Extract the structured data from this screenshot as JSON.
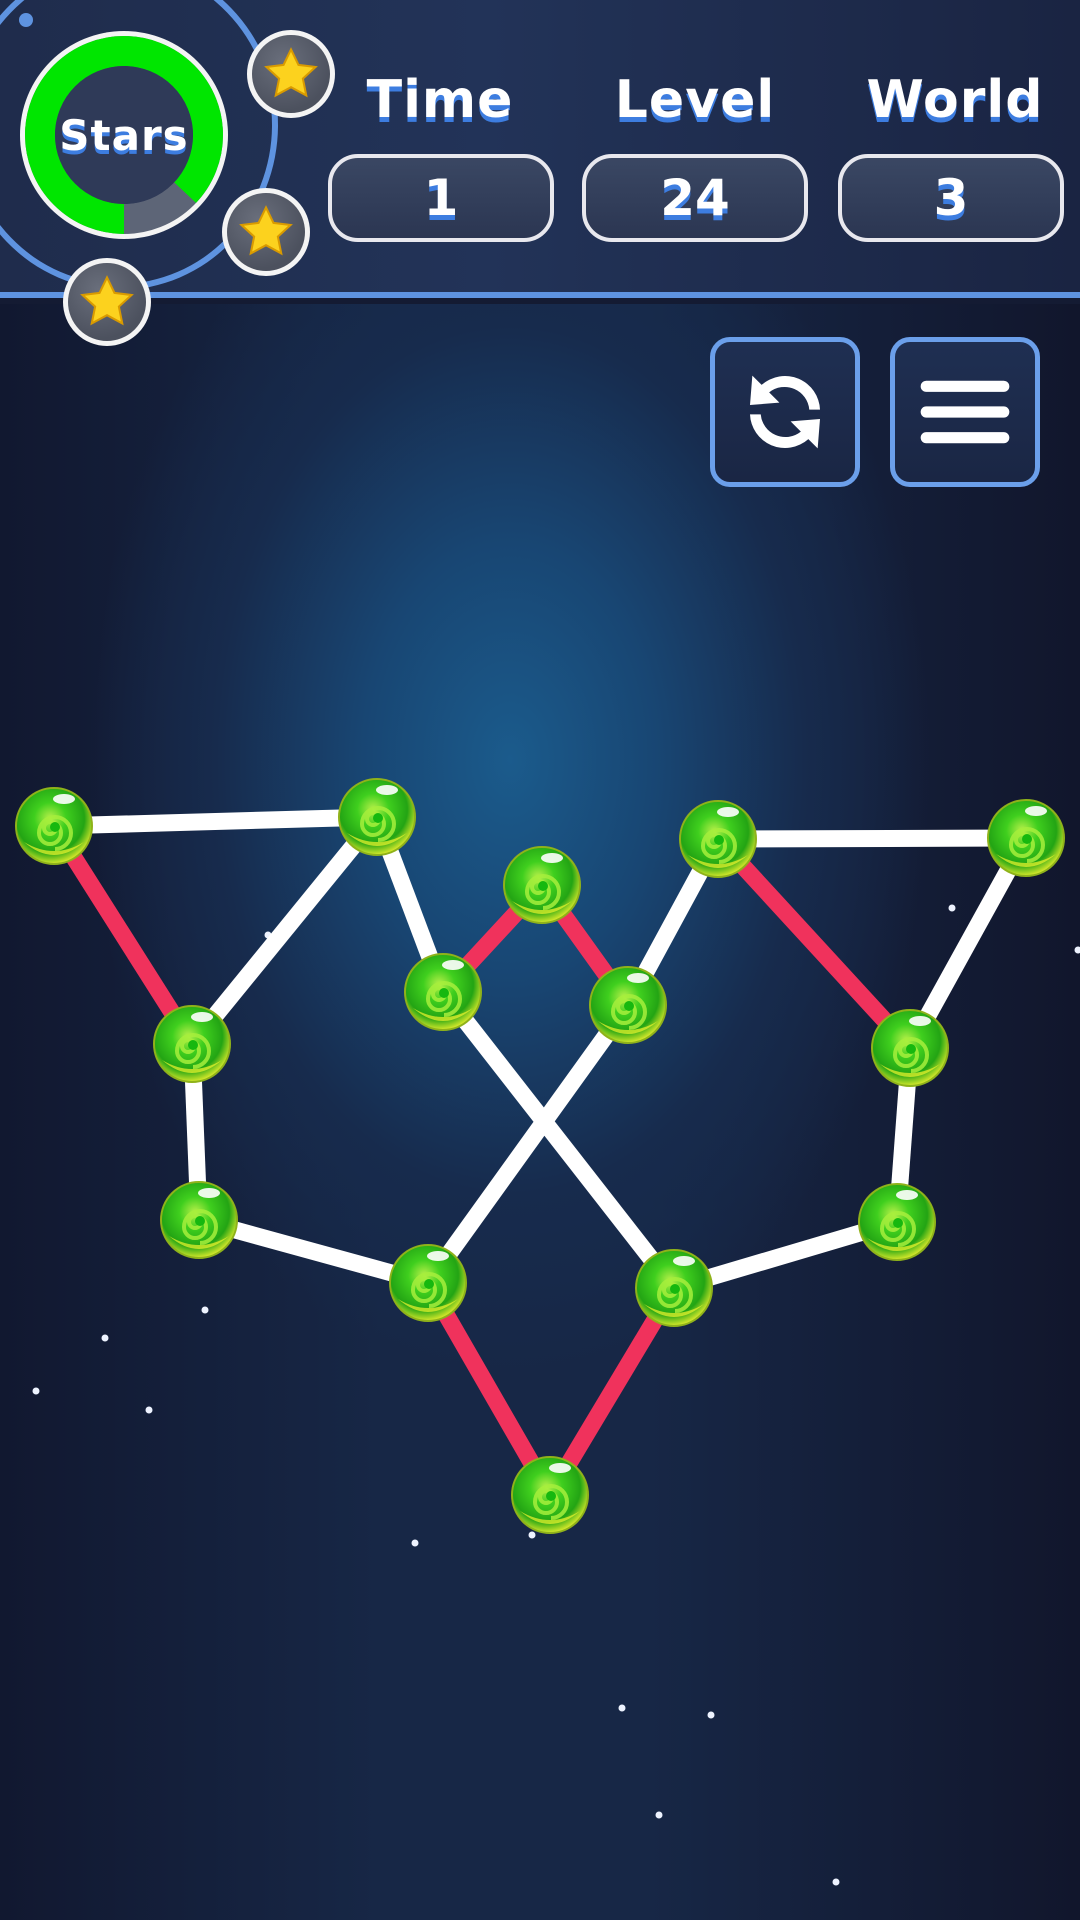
{
  "hud": {
    "stars_label": "Stars",
    "stars_progress": 0.87,
    "stars_earned": 3,
    "stats": [
      {
        "label": "Time",
        "value": "1"
      },
      {
        "label": "Level",
        "value": "24"
      },
      {
        "label": "World",
        "value": "3"
      }
    ]
  },
  "controls": {
    "restart_icon": "refresh-icon",
    "menu_icon": "hamburger-menu-icon"
  },
  "colors": {
    "accent_blue": "#5e93e0",
    "gauge_green": "#00e600",
    "gauge_empty": "#5d6577",
    "edge_crossing": "#f0325c",
    "edge_clear": "#ffffff",
    "node_green": "#33c41a",
    "star_yellow": "#fcd21e"
  },
  "puzzle": {
    "type": "untangle-graph",
    "nodes": [
      {
        "id": "A"
      },
      {
        "id": "B"
      },
      {
        "id": "C"
      },
      {
        "id": "D"
      },
      {
        "id": "E"
      },
      {
        "id": "F"
      },
      {
        "id": "G"
      },
      {
        "id": "H"
      },
      {
        "id": "I"
      },
      {
        "id": "J"
      },
      {
        "id": "K"
      },
      {
        "id": "L"
      },
      {
        "id": "M"
      },
      {
        "id": "N"
      }
    ],
    "edges": [
      {
        "from": "A",
        "to": "B",
        "state": "clear"
      },
      {
        "from": "A",
        "to": "C",
        "state": "crossing"
      },
      {
        "from": "B",
        "to": "C",
        "state": "clear"
      },
      {
        "from": "B",
        "to": "E",
        "state": "clear"
      },
      {
        "from": "C",
        "to": "D",
        "state": "clear"
      },
      {
        "from": "D",
        "to": "L",
        "state": "clear"
      },
      {
        "from": "E",
        "to": "F",
        "state": "crossing"
      },
      {
        "from": "F",
        "to": "I",
        "state": "crossing"
      },
      {
        "from": "E",
        "to": "M",
        "state": "clear"
      },
      {
        "from": "I",
        "to": "L",
        "state": "clear"
      },
      {
        "from": "I",
        "to": "G",
        "state": "clear"
      },
      {
        "from": "G",
        "to": "H",
        "state": "clear"
      },
      {
        "from": "G",
        "to": "J",
        "state": "crossing"
      },
      {
        "from": "H",
        "to": "J",
        "state": "clear"
      },
      {
        "from": "J",
        "to": "K",
        "state": "clear"
      },
      {
        "from": "K",
        "to": "M",
        "state": "clear"
      },
      {
        "from": "L",
        "to": "N",
        "state": "crossing"
      },
      {
        "from": "M",
        "to": "N",
        "state": "crossing"
      }
    ]
  }
}
